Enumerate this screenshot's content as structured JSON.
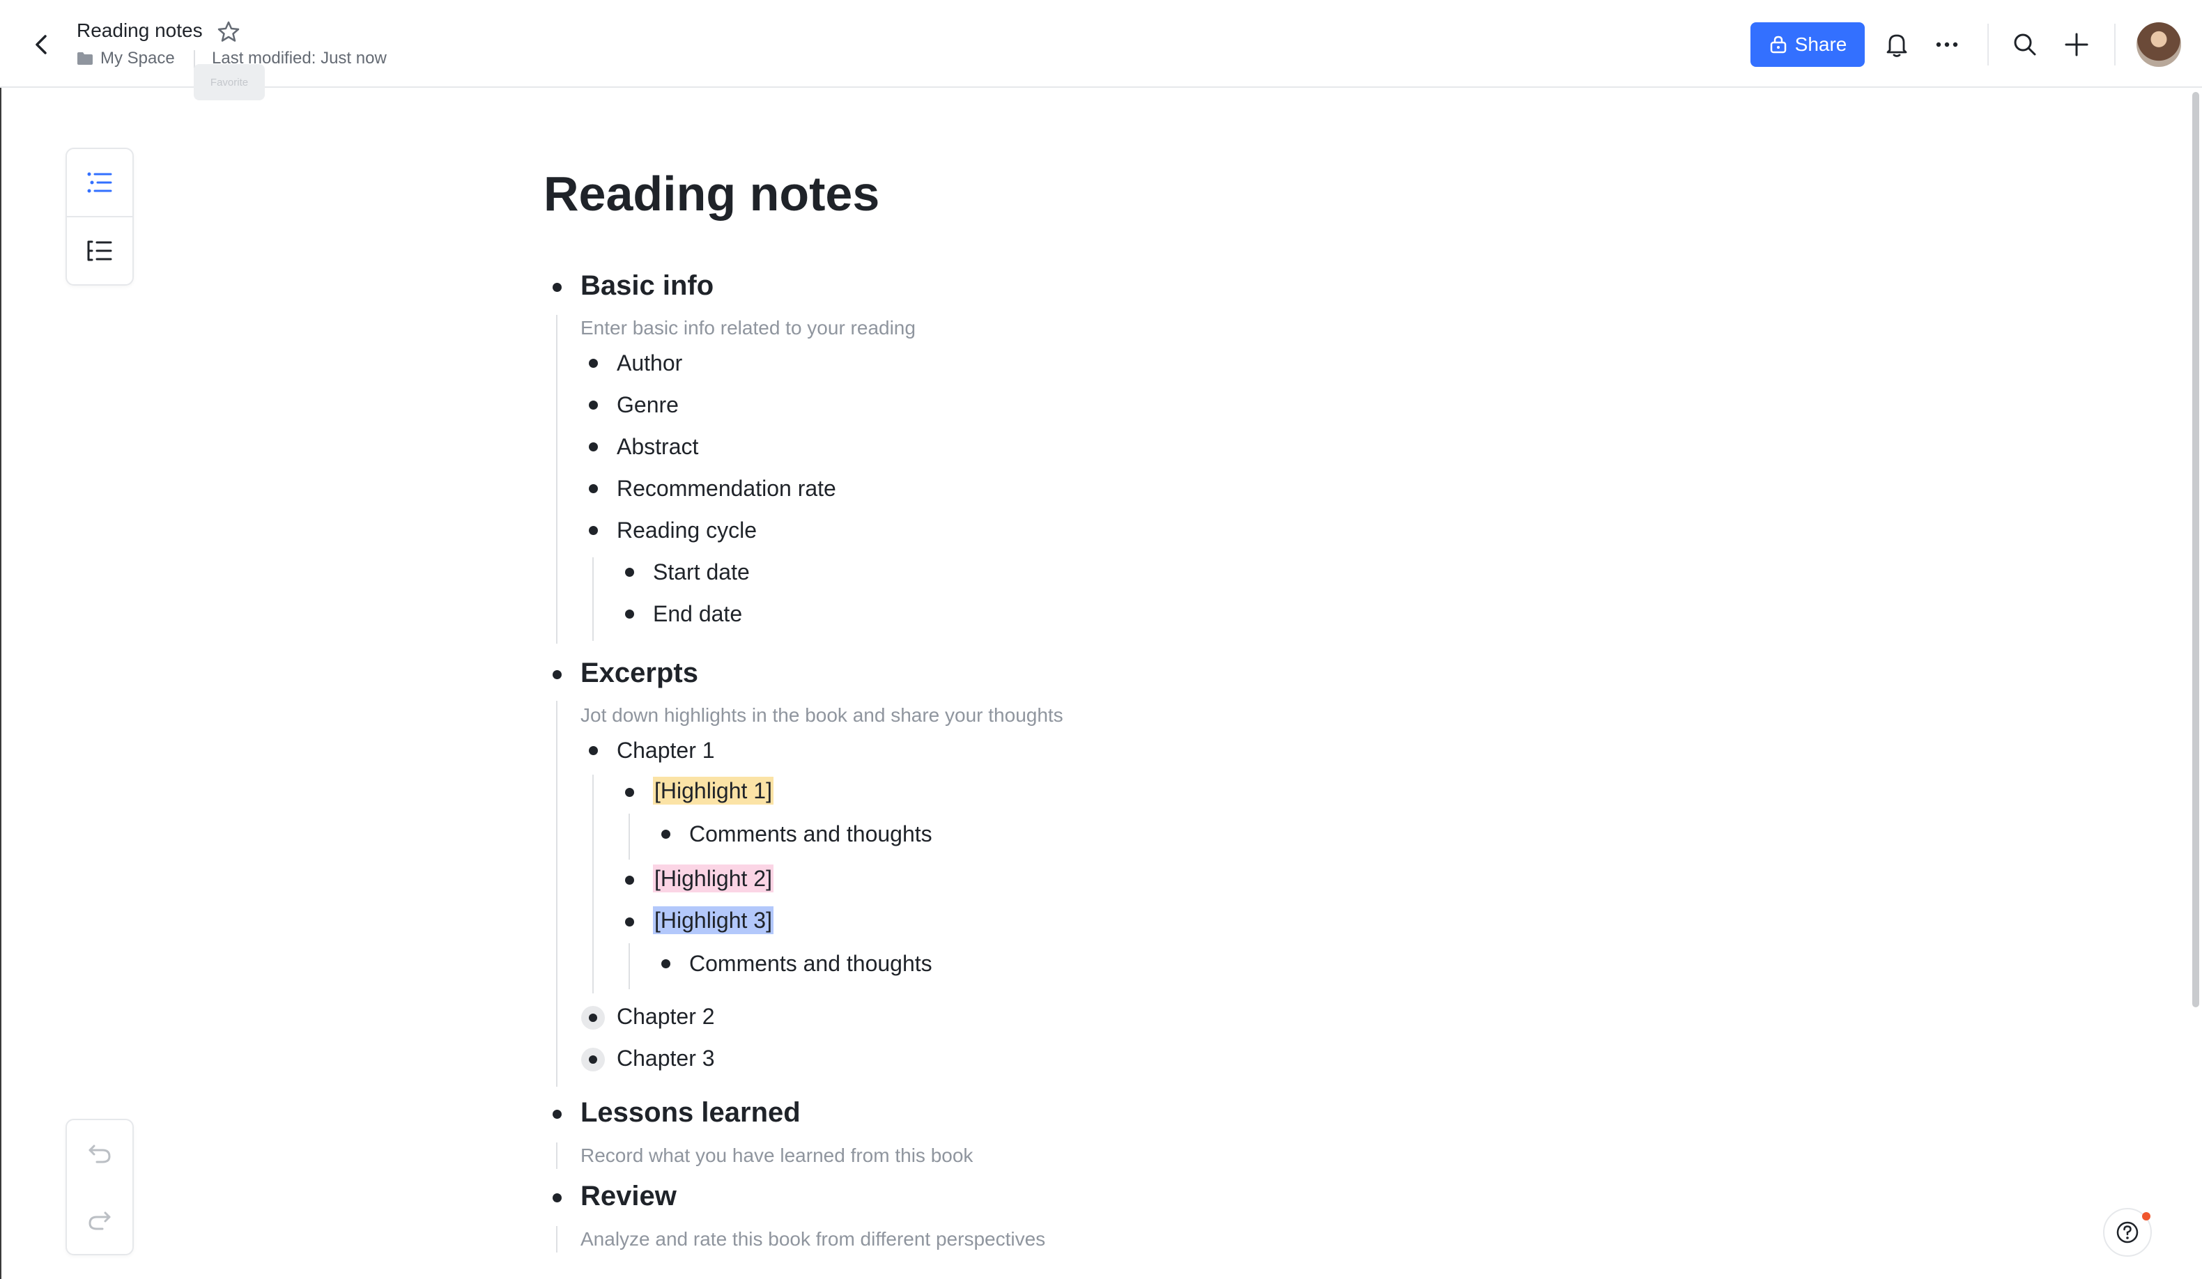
{
  "header": {
    "title": "Reading notes",
    "breadcrumb": "My Space",
    "modified": "Last modified: Just now",
    "tooltip": "Favorite",
    "share_label": "Share"
  },
  "document": {
    "title": "Reading notes",
    "sections": [
      {
        "heading": "Basic info",
        "hint": "Enter basic info related to your reading"
      },
      {
        "heading": "Excerpts",
        "hint": "Jot down highlights in the book and share your thoughts"
      },
      {
        "heading": "Lessons learned",
        "hint": "Record what you have learned from this book"
      },
      {
        "heading": "Review",
        "hint": "Analyze and rate this book from different perspectives"
      }
    ],
    "basic_items": [
      "Author",
      "Genre",
      "Abstract",
      "Recommendation rate",
      "Reading cycle"
    ],
    "cycle_items": [
      "Start date",
      "End date"
    ],
    "chapters": [
      "Chapter 1",
      "Chapter 2",
      "Chapter 3"
    ],
    "highlights": [
      "[Highlight 1]",
      "[Highlight 2]",
      "[Highlight 3]"
    ],
    "comment": "Comments and thoughts"
  },
  "colors": {
    "accent": "#3370ff",
    "highlight_1": "#fbe3a6",
    "highlight_2": "#fbd5e5",
    "highlight_3": "#b3c8fb"
  },
  "icons": [
    "back-arrow-icon",
    "star-icon",
    "folder-icon",
    "lock-icon",
    "bell-icon",
    "more-icon",
    "search-icon",
    "plus-icon",
    "outline-icon",
    "collapse-outline-icon",
    "undo-icon",
    "redo-icon",
    "help-icon"
  ]
}
